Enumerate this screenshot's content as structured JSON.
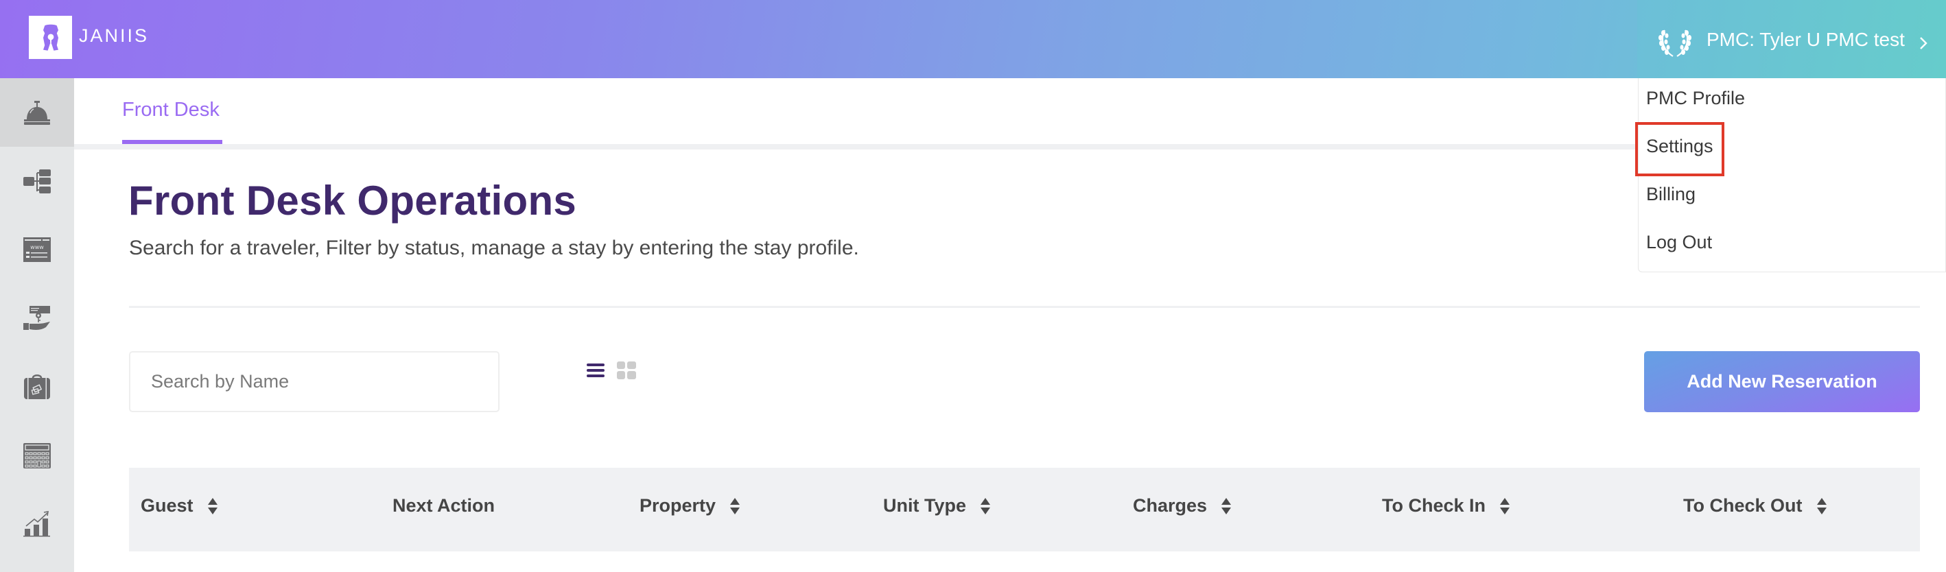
{
  "app": {
    "brand": "JANIIS",
    "brand_gradient": [
      "#9670f1",
      "#66cdca"
    ],
    "accent_color": "#9a6bf2",
    "title_color": "#40296c"
  },
  "header": {
    "user_label": "PMC: Tyler U PMC test",
    "user_icon": "laurel-wreath-icon",
    "chevron_icon": "chevron-right-icon"
  },
  "user_menu": {
    "items": [
      {
        "label": "PMC Profile"
      },
      {
        "label": "Settings",
        "highlighted": true
      },
      {
        "label": "Billing"
      },
      {
        "label": "Log Out"
      }
    ],
    "highlight_color": "#e03a2a"
  },
  "sidebar": {
    "items": [
      {
        "icon": "front-desk-bell-icon",
        "active": true
      },
      {
        "icon": "hierarchy-icon",
        "active": false
      },
      {
        "icon": "website-icon",
        "active": false
      },
      {
        "icon": "key-handover-icon",
        "active": false
      },
      {
        "icon": "luggage-icon",
        "active": false
      },
      {
        "icon": "calculator-icon",
        "active": false
      },
      {
        "icon": "growth-chart-icon",
        "active": false
      }
    ]
  },
  "tabs": [
    {
      "label": "Front Desk",
      "active": true
    }
  ],
  "page": {
    "title": "Front Desk Operations",
    "subtitle": "Search for a traveler, Filter by status, manage a stay by entering the stay profile."
  },
  "controls": {
    "search_placeholder": "Search by Name",
    "search_value": "",
    "view_mode": "list",
    "add_button_label": "Add New Reservation"
  },
  "table": {
    "columns": [
      {
        "label": "Guest",
        "sortable": true
      },
      {
        "label": "Next Action",
        "sortable": false
      },
      {
        "label": "Property",
        "sortable": true
      },
      {
        "label": "Unit Type",
        "sortable": true
      },
      {
        "label": "Charges",
        "sortable": true
      },
      {
        "label": "To Check In",
        "sortable": true
      },
      {
        "label": "To Check Out",
        "sortable": true
      }
    ]
  }
}
